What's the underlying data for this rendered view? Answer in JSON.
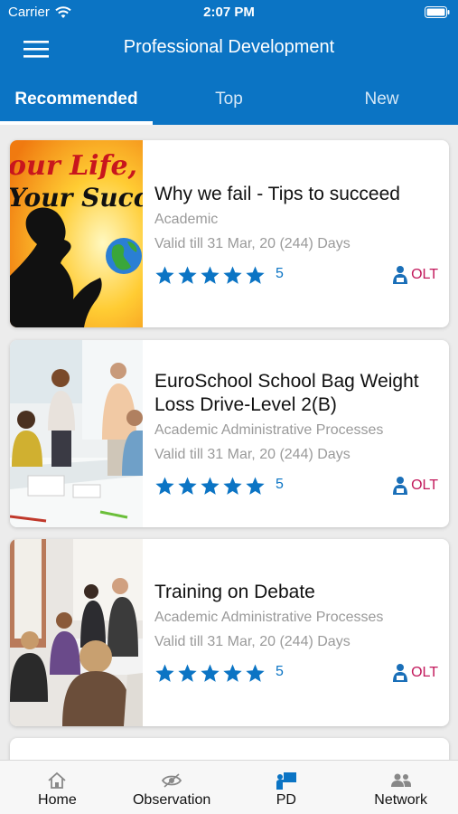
{
  "status_bar": {
    "carrier": "Carrier",
    "time": "2:07 PM"
  },
  "header": {
    "title": "Professional Development"
  },
  "tabs": [
    {
      "label": "Recommended",
      "active": true
    },
    {
      "label": "Top",
      "active": false
    },
    {
      "label": "New",
      "active": false
    }
  ],
  "courses": [
    {
      "image_text": "our Life, Your Succes",
      "title": "Why we fail - Tips to succeed",
      "category": "Academic",
      "validity": "Valid till 31 Mar, 20 (244) Days",
      "stars": 5,
      "rating": "5",
      "badge": "OLT"
    },
    {
      "title": "EuroSchool School Bag Weight Loss Drive-Level 2(B)",
      "category": "Academic Administrative Processes",
      "validity": "Valid till 31 Mar, 20 (244) Days",
      "stars": 5,
      "rating": "5",
      "badge": "OLT"
    },
    {
      "title": "Training on Debate",
      "category": "Academic Administrative Processes",
      "validity": "Valid till 31 Mar, 20 (244) Days",
      "stars": 5,
      "rating": "5",
      "badge": "OLT"
    }
  ],
  "bottom_nav": [
    {
      "label": "Home",
      "icon": "home-icon"
    },
    {
      "label": "Observation",
      "icon": "observation-icon"
    },
    {
      "label": "PD",
      "icon": "pd-icon",
      "active": true
    },
    {
      "label": "Network",
      "icon": "network-icon"
    }
  ],
  "colors": {
    "primary": "#0b74c4",
    "badge": "#c2185b",
    "muted": "#9a9a9a"
  }
}
